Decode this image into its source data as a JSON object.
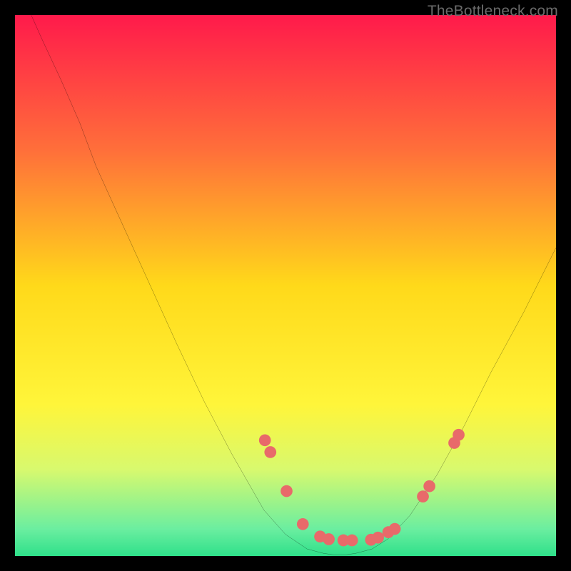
{
  "watermark": "TheBottleneck.com",
  "chart_data": {
    "type": "line",
    "title": "",
    "xlabel": "",
    "ylabel": "",
    "xlim": [
      0,
      100
    ],
    "ylim": [
      0,
      100
    ],
    "grid": false,
    "gradient_stops": [
      {
        "offset": 0,
        "color": "#ff1a4b"
      },
      {
        "offset": 25,
        "color": "#ff6f3a"
      },
      {
        "offset": 50,
        "color": "#ffd91a"
      },
      {
        "offset": 72,
        "color": "#fff53a"
      },
      {
        "offset": 84,
        "color": "#d8f96e"
      },
      {
        "offset": 95,
        "color": "#6beea0"
      },
      {
        "offset": 100,
        "color": "#2fe08a"
      }
    ],
    "series": [
      {
        "name": "bottleneck-curve",
        "stroke": "#000000",
        "x": [
          3,
          5,
          8.5,
          12,
          15,
          20,
          25,
          30,
          35,
          40,
          46,
          50,
          54,
          57,
          59,
          61,
          63,
          66,
          69,
          73,
          78,
          83,
          88,
          94,
          100
        ],
        "y": [
          100,
          95.5,
          88,
          80,
          72,
          61,
          50,
          39,
          28.5,
          19,
          8.5,
          4,
          1.3,
          0.5,
          0.2,
          0.2,
          0.5,
          1.3,
          3.2,
          7.5,
          15,
          24,
          34,
          45,
          57
        ]
      }
    ],
    "markers": {
      "color": "#e86a6a",
      "radius": 1.1,
      "points": [
        {
          "x": 46.2,
          "y": 21.4
        },
        {
          "x": 47.2,
          "y": 19.2
        },
        {
          "x": 50.2,
          "y": 12.0
        },
        {
          "x": 53.2,
          "y": 5.9
        },
        {
          "x": 56.4,
          "y": 3.6
        },
        {
          "x": 58.0,
          "y": 3.1
        },
        {
          "x": 60.7,
          "y": 2.9
        },
        {
          "x": 62.3,
          "y": 2.9
        },
        {
          "x": 65.8,
          "y": 3.0
        },
        {
          "x": 67.1,
          "y": 3.4
        },
        {
          "x": 69.0,
          "y": 4.4
        },
        {
          "x": 70.2,
          "y": 5.0
        },
        {
          "x": 75.4,
          "y": 11.0
        },
        {
          "x": 76.6,
          "y": 12.9
        },
        {
          "x": 81.2,
          "y": 20.9
        },
        {
          "x": 82.0,
          "y": 22.4
        }
      ]
    }
  }
}
